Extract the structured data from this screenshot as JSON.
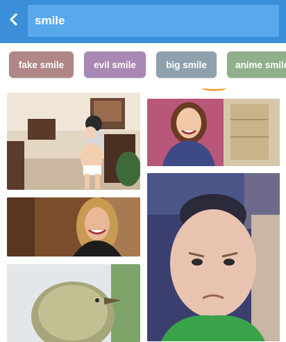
{
  "search": {
    "query": "smile"
  },
  "chips": [
    {
      "label": "fake smile",
      "color": "#b08686"
    },
    {
      "label": "evil smile",
      "color": "#a888b4"
    },
    {
      "label": "big smile",
      "color": "#8ea1ad"
    },
    {
      "label": "anime smile",
      "color": "#8fb08a"
    }
  ],
  "colors": {
    "topbar": "#3a8fd8",
    "search_box": "#5aa8ec",
    "accent": "#f4a53a"
  },
  "icons": {
    "back": "chevron-left-icon"
  }
}
